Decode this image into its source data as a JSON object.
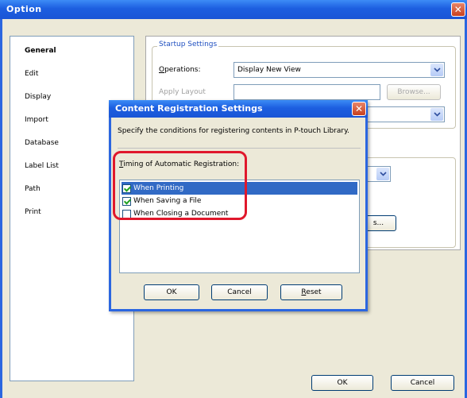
{
  "window": {
    "title": "Option",
    "close_icon": "close-icon"
  },
  "sidebar": {
    "items": [
      {
        "label": "General"
      },
      {
        "label": "Edit"
      },
      {
        "label": "Display"
      },
      {
        "label": "Import"
      },
      {
        "label": "Database"
      },
      {
        "label": "Label List"
      },
      {
        "label": "Path"
      },
      {
        "label": "Print"
      }
    ]
  },
  "main": {
    "startup_group_title": "Startup Settings",
    "operations_label": "Operations:",
    "operations_value": "Display New View",
    "apply_layout_label": "Apply Layout",
    "browse_label": "Browse...",
    "second_button_label": "s..."
  },
  "footer": {
    "ok_label": "OK",
    "cancel_label": "Cancel"
  },
  "dialog": {
    "title": "Content Registration Settings",
    "description": "Specify the conditions for registering contents in P-touch Library.",
    "timing_label": "Timing of Automatic Registration:",
    "options": [
      {
        "label": "When Printing",
        "checked": true,
        "selected": true
      },
      {
        "label": "When Saving a File",
        "checked": true,
        "selected": false
      },
      {
        "label": "When Closing a Document",
        "checked": false,
        "selected": false
      }
    ],
    "ok_label": "OK",
    "cancel_label": "Cancel",
    "reset_label": "Reset"
  },
  "colors": {
    "titlebar": "#1c5ee0",
    "highlight": "#e0182c",
    "selection": "#316ac5"
  }
}
